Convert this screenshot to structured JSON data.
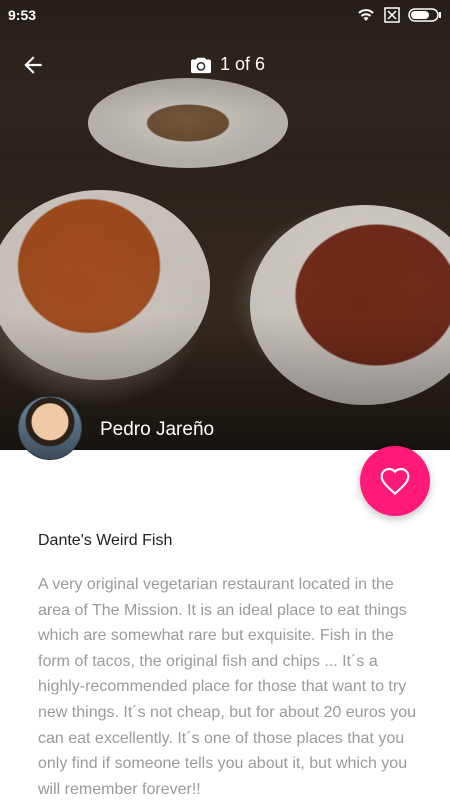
{
  "status_bar": {
    "time": "9:53",
    "icons": [
      "wifi-icon",
      "sim-off-icon",
      "battery-icon"
    ]
  },
  "topbar": {
    "back_icon": "arrow-left-icon",
    "camera_icon": "camera-icon",
    "counter": "1 of 6"
  },
  "author": {
    "name": "Pedro Jareño"
  },
  "fab": {
    "icon": "heart-outline-icon",
    "color": "#ff1a7a"
  },
  "place": {
    "title": "Dante's Weird Fish",
    "description": "A very original vegetarian restaurant located in the area of The Mission. It is an ideal place to eat things which are somewhat rare but exquisite. Fish in the form of tacos, the original fish and chips ... It´s a highly-recommended place for those that want to try new things. It´s not cheap, but for about 20 euros you can eat excellently. It´s one of those places that you only find if someone tells you about it, but which you will remember forever!!"
  }
}
